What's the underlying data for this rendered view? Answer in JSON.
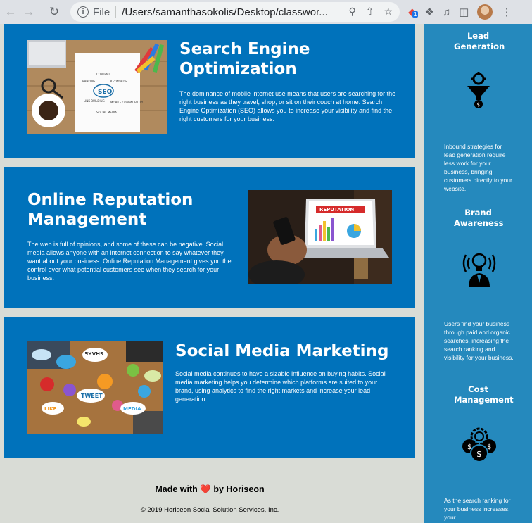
{
  "browser": {
    "scheme": "File",
    "url": "/Users/samanthasokolis/Desktop/classwor...",
    "extension_badge": "1"
  },
  "sections": [
    {
      "title": "Search Engine Optimization",
      "body": "The dominance of mobile internet use means that users are searching for the right business as they travel, shop, or sit on their couch at home. Search Engine Optimization (SEO) allows you to increase your visibility and find the right customers for your business.",
      "image_text": [
        "SEO",
        "CONTENT",
        "KEYWORDS",
        "RANKING",
        "LINK BUILDING",
        "MOBILE COMPATIBILITY",
        "SOCIAL MEDIA"
      ]
    },
    {
      "title": "Online Reputation Management",
      "body": "The web is full of opinions, and some of these can be negative. Social media allows anyone with an internet connection to say whatever they want about your business. Online Reputation Management gives you the control over what potential customers see when they search for your business.",
      "image_text": "REPUTATION"
    },
    {
      "title": "Social Media Marketing",
      "body": "Social media continues to have a sizable influence on buying habits. Social media marketing helps you determine which platforms are suited to your brand, using analytics to find the right markets and increase your lead generation.",
      "image_text": [
        "SHARE",
        "TWEET",
        "LIKE",
        "MEDIA"
      ]
    }
  ],
  "benefits": [
    {
      "title": "Lead Generation",
      "icon": "lead-generation-icon",
      "body": "Inbound strategies for lead generation require less work for your business, bringing customers directly to your website."
    },
    {
      "title": "Brand Awareness",
      "icon": "brand-awareness-icon",
      "body": "Users find your business through paid and organic searches, increasing the search ranking and visibility for your business."
    },
    {
      "title": "Cost Management",
      "icon": "cost-management-icon",
      "body": "As the search ranking for your business increases, your"
    }
  ],
  "footer": {
    "made_with_prefix": "Made with",
    "heart": "❤️",
    "made_with_suffix": "by Horiseon",
    "copyright": "© 2019 Horiseon Social Solution Services, Inc."
  },
  "colors": {
    "section_bg": "#0072bb",
    "sidebar_bg": "#2589bd",
    "page_bg": "#d9dcd6"
  }
}
